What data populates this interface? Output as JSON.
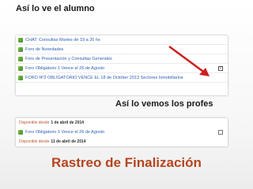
{
  "captions": {
    "student": "Así lo ve el alumno",
    "teacher": "Así lo vemos los profes",
    "title": "Rastreo de Finalización"
  },
  "student_view": {
    "rows": [
      {
        "label": "CHAT: Consultas Martes de 19 a 20 hs",
        "icon": "chat-icon",
        "checkmark": ""
      },
      {
        "label": "Foro de Novedades",
        "icon": "forum-icon",
        "checkmark": ""
      },
      {
        "label": "Foro de Presentación y Consultas Generales",
        "icon": "forum-icon",
        "checkmark": ""
      },
      {
        "label": "Foro Obligatorio 1 Vence el 26 de Agosto",
        "icon": "forum-icon",
        "checkmark": "✓"
      },
      {
        "label": "FORO Nº2 OBLIGATORIO VENCE EL 18 de October 2013 Sectores Inmobiliarios",
        "icon": "forum-icon",
        "checkmark": ""
      }
    ]
  },
  "teacher_view": {
    "rows": [
      {
        "avail_label": "Disponible desde",
        "avail_date": "1 de abril de 2014"
      },
      {
        "label": "Foro Obligatorio 1 Vence el 26 de Agosto"
      },
      {
        "avail_label": "Disponible desde",
        "avail_date": "11 de abril de 2014"
      }
    ]
  },
  "colors": {
    "accent_title": "#b5451f",
    "link": "#2d5fb3",
    "arrow": "#cc1f1f"
  }
}
